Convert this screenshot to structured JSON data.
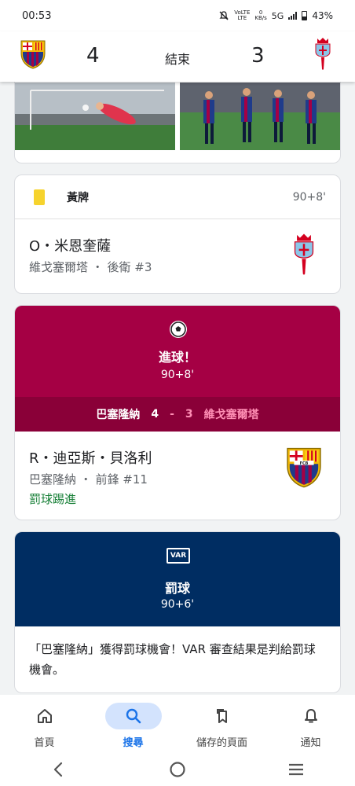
{
  "status_bar": {
    "time": "00:53",
    "lte_top": "VoLTE",
    "lte_bottom": "LTE",
    "speed_top": "0",
    "speed_bottom": "KB/s",
    "network": "5G",
    "battery": "43%"
  },
  "score_header": {
    "home_score": "4",
    "status": "結束",
    "away_score": "3"
  },
  "yellow_card_event": {
    "type": "黃牌",
    "minute": "90+8'",
    "player": "O・米恩奎薩",
    "meta": "維戈塞爾塔 ・ 後衛 #3"
  },
  "goal_event": {
    "title": "進球！",
    "minute": "90+8'",
    "home_team": "巴塞隆納",
    "home_score": "4",
    "separator": "-",
    "away_score": "3",
    "away_team": "維戈塞爾塔",
    "player": "R・迪亞斯・貝洛利",
    "meta": "巴塞隆納 ・ 前鋒 #11",
    "detail": "罰球踢進"
  },
  "var_event": {
    "icon_label": "VAR",
    "title": "罰球",
    "minute": "90+6'",
    "text": "「巴塞隆納」獲得罰球機會！VAR 審查結果是判給罰球機會。"
  },
  "crest_barca_label": "FCB",
  "bottom_nav": [
    {
      "label": "首頁",
      "icon": "home-icon",
      "active": false
    },
    {
      "label": "搜尋",
      "icon": "search-icon",
      "active": true
    },
    {
      "label": "儲存的頁面",
      "icon": "bookmarks-icon",
      "active": false
    },
    {
      "label": "通知",
      "icon": "bell-icon",
      "active": false
    }
  ],
  "colors": {
    "barca": "#a50044",
    "var": "#002d62",
    "accent": "#1a73e8",
    "detail_green": "#188038",
    "yellow_card": "#f6d32d"
  }
}
